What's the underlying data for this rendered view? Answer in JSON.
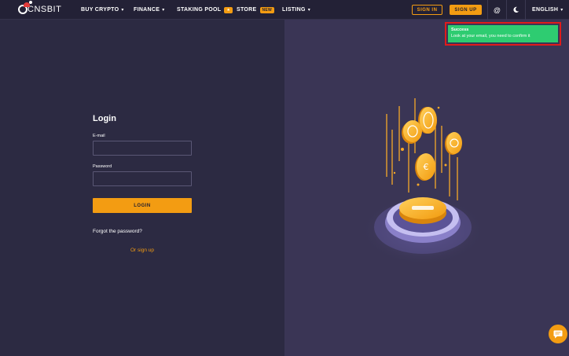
{
  "header": {
    "logo_text": "CNSBIT",
    "nav": [
      {
        "label": "BUY CRYPTO",
        "caret": "▾"
      },
      {
        "label": "FINANCE",
        "caret": "▾"
      },
      {
        "label": "STAKING POOL",
        "badge": "★"
      },
      {
        "label": "STORE",
        "badge": "NEW"
      },
      {
        "label": "LISTING",
        "caret": "▾"
      }
    ],
    "sign_in": "SIGN IN",
    "sign_up": "SIGN UP",
    "language": "ENGLISH",
    "language_caret": "▾",
    "at_symbol": "@"
  },
  "login": {
    "title": "Login",
    "email_label": "E-mail",
    "email_value": "",
    "password_label": "Password",
    "password_value": "",
    "submit": "LOGIN",
    "forgot": "Forgot the password?",
    "signup": "Or sign up"
  },
  "toast": {
    "title": "Success",
    "message": "Look at your email, you need to confirm it"
  },
  "colors": {
    "accent": "#f39c12",
    "background": "#2c2a42",
    "hero_background": "#3a3555",
    "success": "#2ecc71",
    "toast_outline": "#e01b1b"
  },
  "icons": {
    "theme": "moon-icon",
    "chat": "chat-icon",
    "hero": "coins-illustration"
  }
}
